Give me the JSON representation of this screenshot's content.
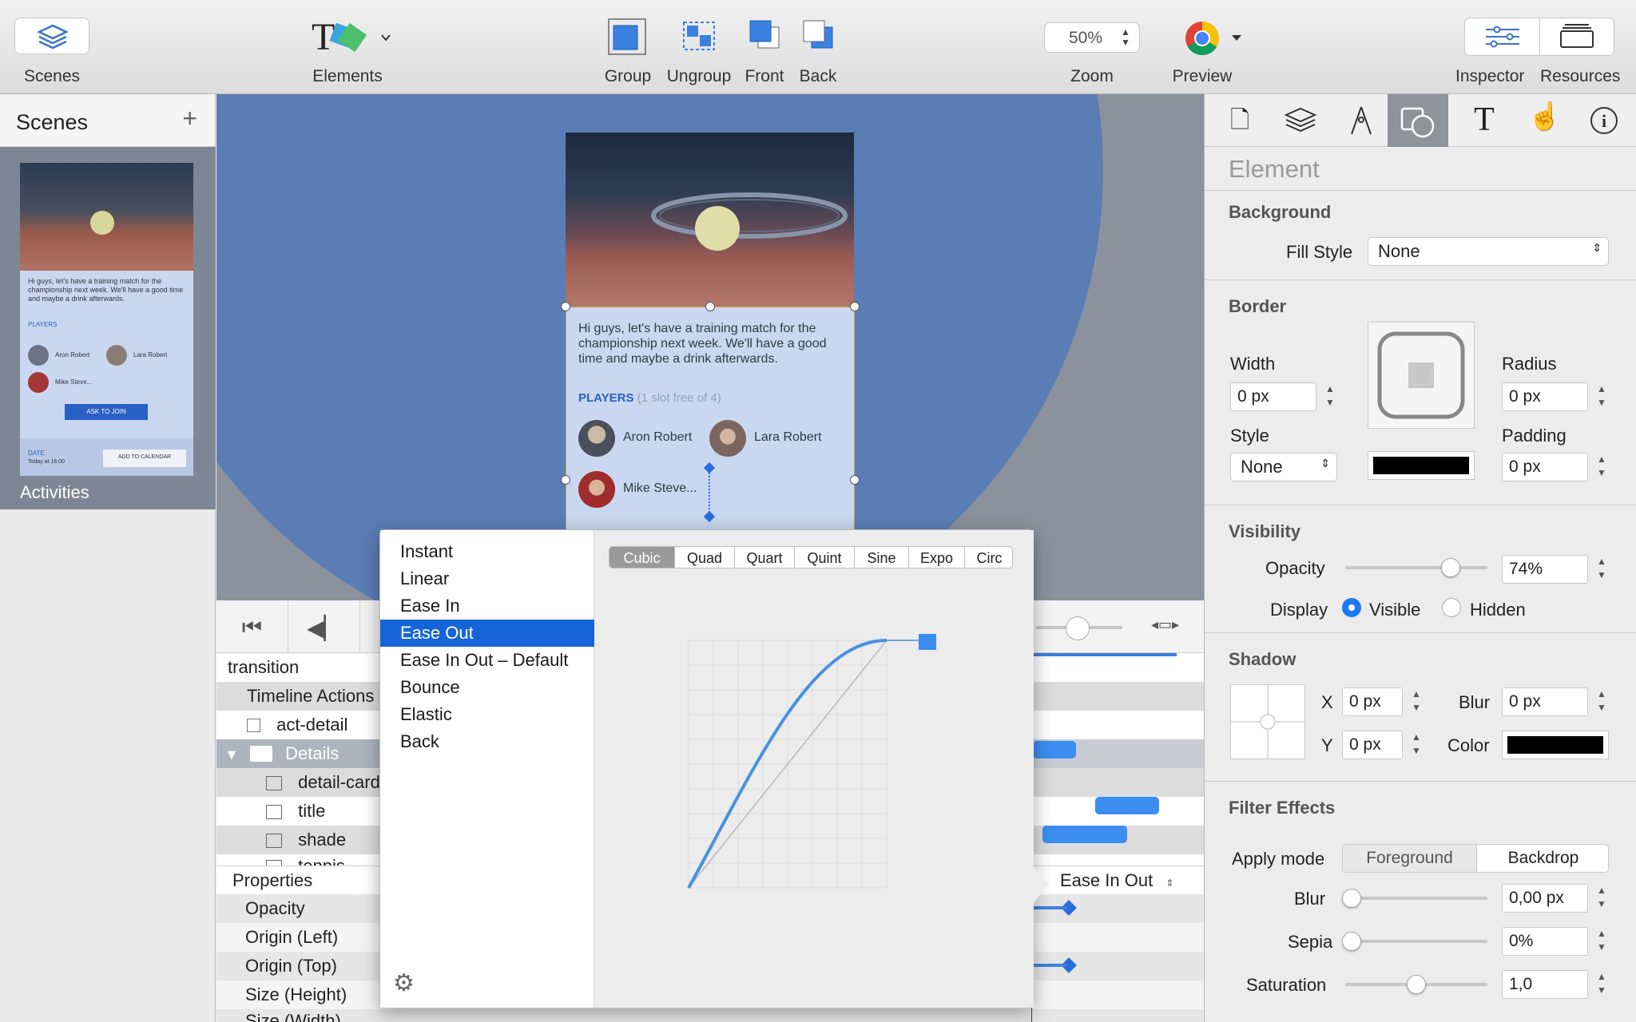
{
  "toolbar": {
    "scenes_label": "Scenes",
    "elements_label": "Elements",
    "group_label": "Group",
    "ungroup_label": "Ungroup",
    "front_label": "Front",
    "back_label": "Back",
    "zoom_label": "Zoom",
    "zoom_value": "50%",
    "preview_label": "Preview",
    "inspector_label": "Inspector",
    "resources_label": "Resources"
  },
  "scenes": {
    "title": "Scenes",
    "add_icon": "plus-icon",
    "scene_name": "Activities"
  },
  "card": {
    "message": "Hi guys, let's have a training match for the championship next week. We'll have a good time and maybe a drink afterwards.",
    "players_label": "PLAYERS",
    "players_note": "(1 slot free of 4)",
    "player1": "Aron Robert",
    "player2": "Lara Robert",
    "player3": "Mike Steve...",
    "ask_btn": "ASK TO JOIN",
    "date_label": "DATE",
    "date_value": "Today at 16:00",
    "calendar_btn": "ADD TO CALENDAR"
  },
  "inspector": {
    "section_title": "Element",
    "background": {
      "title": "Background",
      "fill_label": "Fill Style",
      "fill_value": "None"
    },
    "border": {
      "title": "Border",
      "width_label": "Width",
      "width_value": "0 px",
      "style_label": "Style",
      "style_value": "None",
      "radius_label": "Radius",
      "radius_value": "0 px",
      "padding_label": "Padding",
      "padding_value": "0 px",
      "color": "#000000"
    },
    "visibility": {
      "title": "Visibility",
      "opacity_label": "Opacity",
      "opacity_value": "74%",
      "opacity_level": 0.74,
      "display_label": "Display",
      "visible_label": "Visible",
      "hidden_label": "Hidden"
    },
    "shadow": {
      "title": "Shadow",
      "x_label": "X",
      "x_value": "0 px",
      "y_label": "Y",
      "y_value": "0 px",
      "blur_label": "Blur",
      "blur_value": "0 px",
      "color_label": "Color",
      "color": "#000000"
    },
    "filters": {
      "title": "Filter Effects",
      "apply_label": "Apply mode",
      "foreground": "Foreground",
      "backdrop": "Backdrop",
      "blur_label": "Blur",
      "blur_value": "0,00 px",
      "sepia_label": "Sepia",
      "sepia_value": "0%",
      "saturation_label": "Saturation",
      "saturation_value": "1,0"
    }
  },
  "timeline": {
    "transition_label": "transition",
    "timeline_actions": "Timeline Actions",
    "act_detail": "act-detail",
    "details_group": "Details",
    "detail_card": "detail-card",
    "title_item": "title",
    "shade_item": "shade",
    "tennis_item": "tennis",
    "properties_label": "Properties",
    "easing_value": "Ease In Out",
    "props": [
      "Opacity",
      "Origin (Left)",
      "Origin (Top)",
      "Size (Height)",
      "Size (Width)"
    ]
  },
  "easing_popup": {
    "items": [
      "Instant",
      "Linear",
      "Ease In",
      "Ease Out",
      "Ease In Out – Default",
      "Bounce",
      "Elastic",
      "Back"
    ],
    "selected": "Ease Out",
    "tabs": [
      "Cubic",
      "Quad",
      "Quart",
      "Quint",
      "Sine",
      "Expo",
      "Circ"
    ],
    "active_tab": "Cubic",
    "settings_icon": "gear-icon"
  },
  "colors": {
    "accent": "#1565d8",
    "canvas_blue": "#5b7db5",
    "curve": "#4a90e2"
  }
}
